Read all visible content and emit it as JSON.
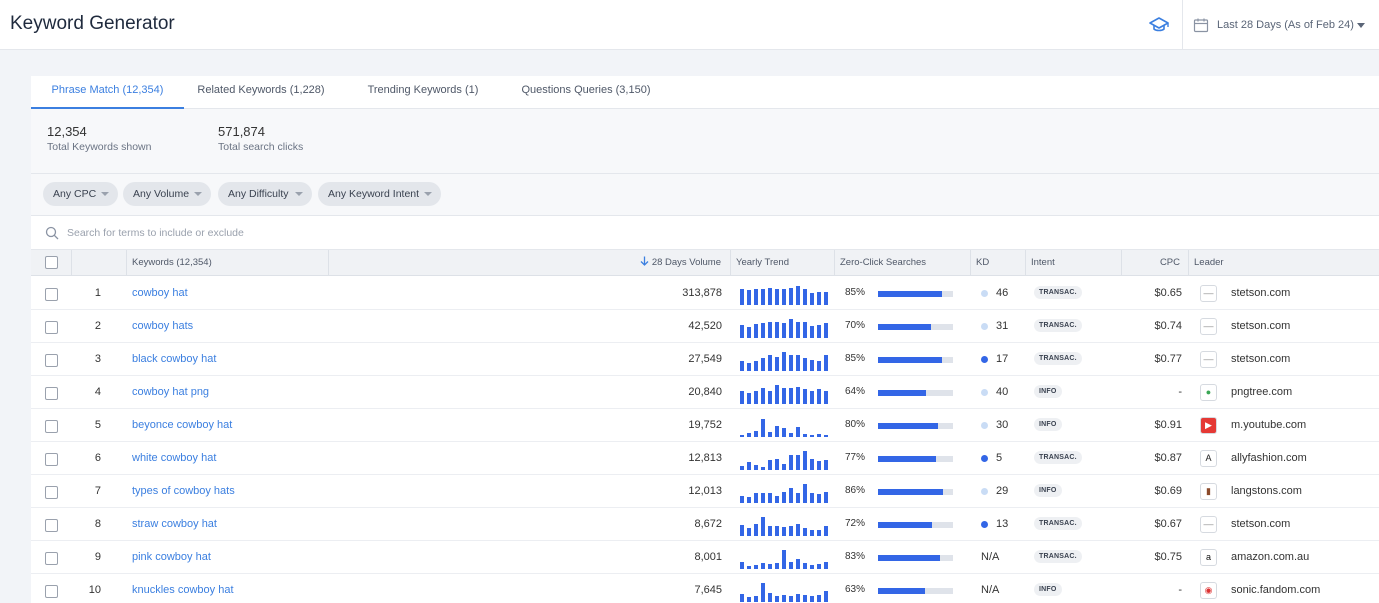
{
  "app": {
    "title": "Keyword Generator",
    "date_range": "Last 28 Days (As of Feb 24)"
  },
  "tabs": [
    {
      "label": "Phrase Match (12,354)",
      "active": true
    },
    {
      "label": "Related Keywords (1,228)",
      "active": false
    },
    {
      "label": "Trending Keywords (1)",
      "active": false
    },
    {
      "label": "Questions Queries (3,150)",
      "active": false
    }
  ],
  "stats": [
    {
      "value": "12,354",
      "label": "Total Keywords shown"
    },
    {
      "value": "571,874",
      "label": "Total search clicks"
    }
  ],
  "filters": [
    "Any CPC",
    "Any Volume",
    "Any Difficulty",
    "Any Keyword Intent"
  ],
  "search": {
    "placeholder": "Search for terms to include or exclude"
  },
  "columns": {
    "keywords": "Keywords (12,354)",
    "volume": "28 Days Volume",
    "trend": "Yearly Trend",
    "zero_click": "Zero-Click Searches",
    "kd": "KD",
    "intent": "Intent",
    "cpc": "CPC",
    "leader": "Leader"
  },
  "colors": {
    "accent": "#3b7fe0",
    "bar": "#3366e6",
    "kd_easy": "#c9dcf5",
    "kd_hard": "#3366e6"
  },
  "rows": [
    {
      "rank": "1",
      "keyword": "cowboy hat",
      "volume": "313,878",
      "trend": [
        0.85,
        0.8,
        0.85,
        0.85,
        0.9,
        0.85,
        0.85,
        0.9,
        1,
        0.85,
        0.65,
        0.7,
        0.7
      ],
      "zero_click": "85%",
      "zc": 0.85,
      "kd": "46",
      "kd_hard": false,
      "intent": "TRANSAC.",
      "cpc": "$0.65",
      "leader_icon": "stetson-icon",
      "leader": "stetson.com"
    },
    {
      "rank": "2",
      "keyword": "cowboy hats",
      "volume": "42,520",
      "trend": [
        0.7,
        0.6,
        0.75,
        0.8,
        0.85,
        0.85,
        0.8,
        1,
        0.85,
        0.85,
        0.65,
        0.7,
        0.8
      ],
      "zero_click": "70%",
      "zc": 0.7,
      "kd": "31",
      "kd_hard": false,
      "intent": "TRANSAC.",
      "cpc": "$0.74",
      "leader_icon": "stetson-icon",
      "leader": "stetson.com"
    },
    {
      "rank": "3",
      "keyword": "black cowboy hat",
      "volume": "27,549",
      "trend": [
        0.5,
        0.4,
        0.5,
        0.7,
        0.85,
        0.75,
        1,
        0.85,
        0.85,
        0.7,
        0.6,
        0.5,
        0.85
      ],
      "zero_click": "85%",
      "zc": 0.85,
      "kd": "17",
      "kd_hard": true,
      "intent": "TRANSAC.",
      "cpc": "$0.77",
      "leader_icon": "stetson-icon",
      "leader": "stetson.com"
    },
    {
      "rank": "4",
      "keyword": "cowboy hat png",
      "volume": "20,840",
      "trend": [
        0.7,
        0.6,
        0.7,
        0.85,
        0.7,
        1,
        0.85,
        0.85,
        0.9,
        0.8,
        0.7,
        0.8,
        0.7
      ],
      "zero_click": "64%",
      "zc": 0.64,
      "kd": "40",
      "kd_hard": false,
      "intent": "INFO",
      "cpc": "-",
      "leader_icon": "pngtree-icon",
      "leader": "pngtree.com"
    },
    {
      "rank": "5",
      "keyword": "beyonce cowboy hat",
      "volume": "19,752",
      "trend": [
        0.12,
        0.2,
        0.3,
        0.95,
        0.25,
        0.6,
        0.45,
        0.2,
        0.5,
        0.15,
        0.1,
        0.15,
        0.1
      ],
      "zero_click": "80%",
      "zc": 0.8,
      "kd": "30",
      "kd_hard": false,
      "intent": "INFO",
      "cpc": "$0.91",
      "leader_icon": "youtube-icon",
      "leader": "m.youtube.com"
    },
    {
      "rank": "6",
      "keyword": "white cowboy hat",
      "volume": "12,813",
      "trend": [
        0.2,
        0.4,
        0.25,
        0.15,
        0.5,
        0.6,
        0.3,
        0.8,
        0.8,
        1,
        0.6,
        0.45,
        0.55
      ],
      "zero_click": "77%",
      "zc": 0.77,
      "kd": "5",
      "kd_hard": true,
      "intent": "TRANSAC.",
      "cpc": "$0.87",
      "leader_icon": "allyfashion-icon",
      "leader": "allyfashion.com"
    },
    {
      "rank": "7",
      "keyword": "types of cowboy hats",
      "volume": "12,013",
      "trend": [
        0.35,
        0.3,
        0.5,
        0.55,
        0.5,
        0.35,
        0.6,
        0.8,
        0.55,
        1,
        0.5,
        0.45,
        0.6
      ],
      "zero_click": "86%",
      "zc": 0.86,
      "kd": "29",
      "kd_hard": false,
      "intent": "INFO",
      "cpc": "$0.69",
      "leader_icon": "langstons-icon",
      "leader": "langstons.com"
    },
    {
      "rank": "8",
      "keyword": "straw cowboy hat",
      "volume": "8,672",
      "trend": [
        0.6,
        0.4,
        0.65,
        1,
        0.5,
        0.55,
        0.45,
        0.5,
        0.65,
        0.4,
        0.3,
        0.3,
        0.5
      ],
      "zero_click": "72%",
      "zc": 0.72,
      "kd": "13",
      "kd_hard": true,
      "intent": "TRANSAC.",
      "cpc": "$0.67",
      "leader_icon": "stetson-icon",
      "leader": "stetson.com"
    },
    {
      "rank": "9",
      "keyword": "pink cowboy hat",
      "volume": "8,001",
      "trend": [
        0.35,
        0.15,
        0.2,
        0.3,
        0.25,
        0.3,
        1,
        0.35,
        0.55,
        0.3,
        0.2,
        0.25,
        0.35
      ],
      "zero_click": "83%",
      "zc": 0.83,
      "kd": "N/A",
      "kd_hard": null,
      "intent": "TRANSAC.",
      "cpc": "$0.75",
      "leader_icon": "amazon-icon",
      "leader": "amazon.com.au"
    },
    {
      "rank": "10",
      "keyword": "knuckles cowboy hat",
      "volume": "7,645",
      "trend": [
        0.4,
        0.25,
        0.3,
        1,
        0.45,
        0.3,
        0.35,
        0.3,
        0.4,
        0.35,
        0.3,
        0.35,
        0.6
      ],
      "zero_click": "63%",
      "zc": 0.63,
      "kd": "N/A",
      "kd_hard": null,
      "intent": "INFO",
      "cpc": "-",
      "leader_icon": "sonic-fandom-icon",
      "leader": "sonic.fandom.com"
    }
  ]
}
